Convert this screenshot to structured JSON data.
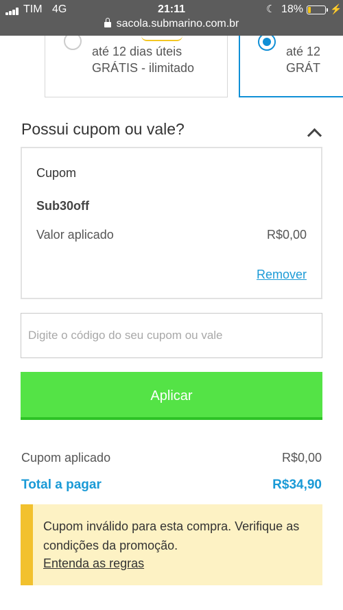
{
  "status_bar": {
    "carrier": "TIM",
    "network": "4G",
    "time": "21:11",
    "battery_percent": "18%",
    "battery_level": 0.18,
    "url": "sacola.submarino.com.br"
  },
  "delivery_options": [
    {
      "line1": "até 12 dias úteis",
      "line2": "GRÁTIS - ilimitado",
      "selected": false
    },
    {
      "line1": "até 12",
      "line2": "GRÁT",
      "selected": true
    }
  ],
  "coupon": {
    "section_title": "Possui cupom ou vale?",
    "card_label": "Cupom",
    "code": "Sub30off",
    "applied_label": "Valor aplicado",
    "applied_value": "R$0,00",
    "remove_link": "Remover",
    "input_placeholder": "Digite o código do seu cupom ou vale",
    "apply_button": "Aplicar"
  },
  "summary": {
    "coupon_applied_label": "Cupom aplicado",
    "coupon_applied_value": "R$0,00",
    "total_label": "Total a pagar",
    "total_value": "R$34,90"
  },
  "warning": {
    "message": "Cupom inválido para esta compra. Verifique as condições da promoção.",
    "link": "Entenda as regras"
  },
  "colors": {
    "accent_blue": "#1a9ad6",
    "apply_green": "#54e346",
    "warning_bg": "#fdf2c4",
    "warning_bar": "#f2c12e"
  }
}
